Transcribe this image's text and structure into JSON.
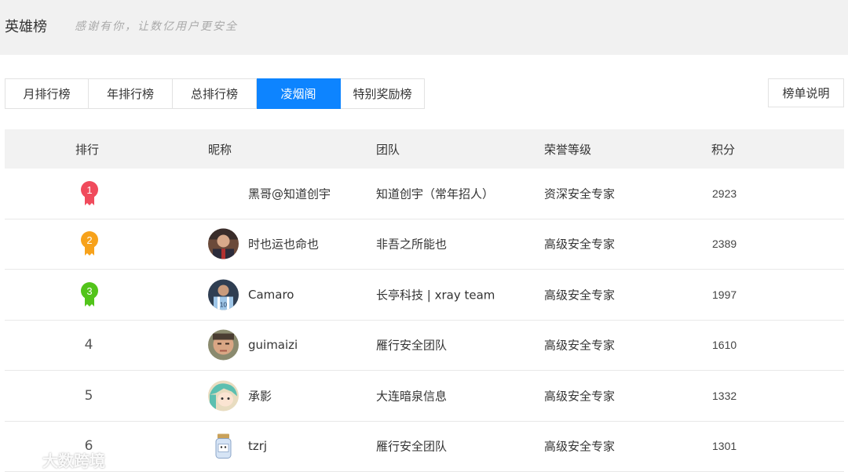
{
  "header": {
    "title": "英雄榜",
    "subtitle": "感谢有你，让数亿用户更安全"
  },
  "tabs": [
    {
      "label": "月排行榜",
      "active": false
    },
    {
      "label": "年排行榜",
      "active": false
    },
    {
      "label": "总排行榜",
      "active": false
    },
    {
      "label": "凌烟阁",
      "active": true
    },
    {
      "label": "特别奖励榜",
      "active": false
    }
  ],
  "desc_button": {
    "label": "榜单说明"
  },
  "table": {
    "headers": {
      "rank": "排行",
      "nickname": "昵称",
      "team": "团队",
      "level": "荣誉等级",
      "score": "积分"
    },
    "rows": [
      {
        "rank": "1",
        "nickname": "黑哥@知道创宇",
        "team": "知道创宇（常年招人）",
        "level": "资深安全专家",
        "score": "2923",
        "medal_color": "#f04b5c",
        "avatar_icon": "none"
      },
      {
        "rank": "2",
        "nickname": "时也运也命也",
        "team": "非吾之所能也",
        "level": "高级安全专家",
        "score": "2389",
        "medal_color": "#f7a21b",
        "avatar_icon": "person-photo-icon"
      },
      {
        "rank": "3",
        "nickname": "Camaro",
        "team": "长亭科技 | xray team",
        "level": "高级安全专家",
        "score": "1997",
        "medal_color": "#52c41a",
        "avatar_icon": "player-photo-icon"
      },
      {
        "rank": "4",
        "nickname": "guimaizi",
        "team": "雁行安全团队",
        "level": "高级安全专家",
        "score": "1610",
        "avatar_icon": "face-photo-icon"
      },
      {
        "rank": "5",
        "nickname": "承影",
        "team": "大连暗泉信息",
        "level": "高级安全专家",
        "score": "1332",
        "avatar_icon": "anime-avatar-icon"
      },
      {
        "rank": "6",
        "nickname": "tzrj",
        "team": "雁行安全团队",
        "level": "高级安全专家",
        "score": "1301",
        "avatar_icon": "jar-avatar-icon"
      }
    ]
  },
  "watermark": {
    "text": "大数跨境"
  }
}
